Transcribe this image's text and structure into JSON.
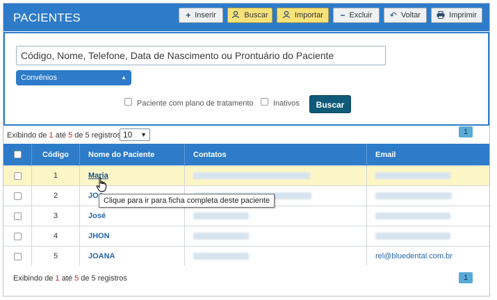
{
  "header": {
    "title": "PACIENTES",
    "buttons": [
      {
        "label": "Inserir",
        "icon": "plus-icon"
      },
      {
        "label": "Buscar",
        "icon": "user-search-icon"
      },
      {
        "label": "Importar",
        "icon": "user-import-icon"
      },
      {
        "label": "Excluir",
        "icon": "minus-icon"
      },
      {
        "label": "Voltar",
        "icon": "back-arrow-icon"
      },
      {
        "label": "Imprimir",
        "icon": "printer-icon"
      }
    ]
  },
  "search": {
    "placeholder": "Código, Nome, Telefone, Data de Nascimento ou Prontuário do Paciente",
    "convenios_label": "Convênios",
    "checkbox_plano": "Paciente com plano de tratamento",
    "checkbox_inativos": "Inativos",
    "button_label": "Buscar"
  },
  "pagination": {
    "top_prefix": "Exibindo de ",
    "from": "1",
    "middle": " até ",
    "to": "5",
    "suffix": " de 5 registros",
    "per_page": "10",
    "page": "1"
  },
  "table": {
    "columns": [
      "Código",
      "Nome do Paciente",
      "Contatos",
      "Email"
    ],
    "rows": [
      {
        "codigo": "1",
        "nome": "Maria",
        "email": ""
      },
      {
        "codigo": "2",
        "nome": "JOA",
        "email": ""
      },
      {
        "codigo": "3",
        "nome": "José",
        "email": ""
      },
      {
        "codigo": "4",
        "nome": "JHON",
        "email": ""
      },
      {
        "codigo": "5",
        "nome": "JOANA",
        "email": "rel@bluedental.com.br"
      }
    ]
  },
  "tooltip": "Clique para ir para ficha completa deste paciente",
  "colors": {
    "primary": "#2d7bc9",
    "highlight_row": "#fcf6c6",
    "search_button": "#0e5a78",
    "accent_red": "#cc2222"
  }
}
